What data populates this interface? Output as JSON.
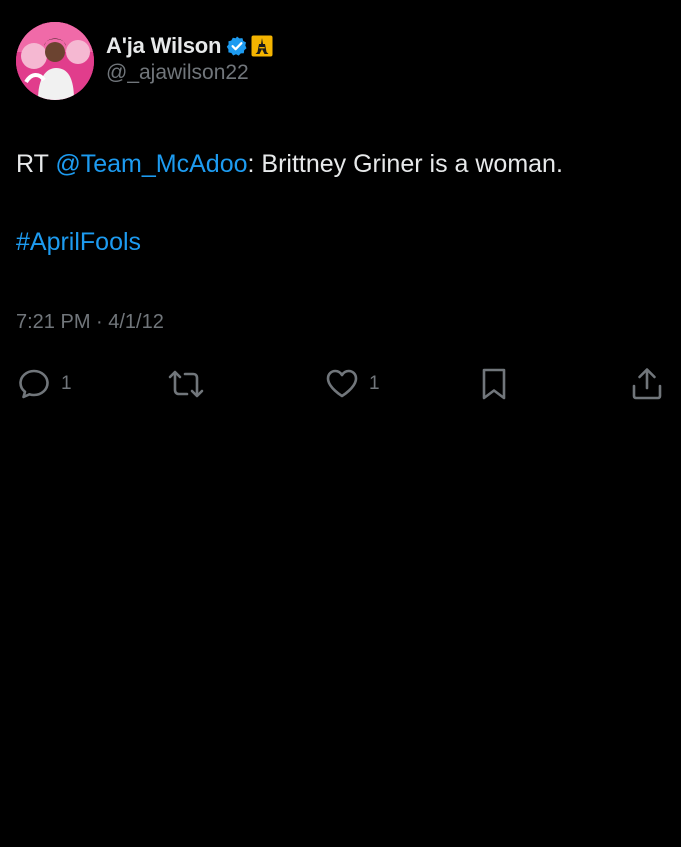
{
  "tweet": {
    "author": {
      "display_name": "A'ja Wilson",
      "handle": "@_ajawilson22"
    },
    "text": {
      "prefix": "RT ",
      "mention": "@Team_McAdoo",
      "body": ": Brittney Griner is a woman.",
      "hashtag": "#AprilFools"
    },
    "timestamp": "7:21 PM · 4/1/12",
    "actions": {
      "reply_count": "1",
      "like_count": "1"
    }
  },
  "colors": {
    "background": "#000000",
    "text": "#e7e9ea",
    "secondary": "#71767b",
    "link": "#1d9bf0",
    "verified": "#1d9bf0",
    "affiliate_badge": "#f4b400"
  },
  "icons": [
    "verified-badge-icon",
    "affiliation-badge-icon",
    "reply-icon",
    "retweet-icon",
    "like-icon",
    "bookmark-icon",
    "share-icon"
  ]
}
